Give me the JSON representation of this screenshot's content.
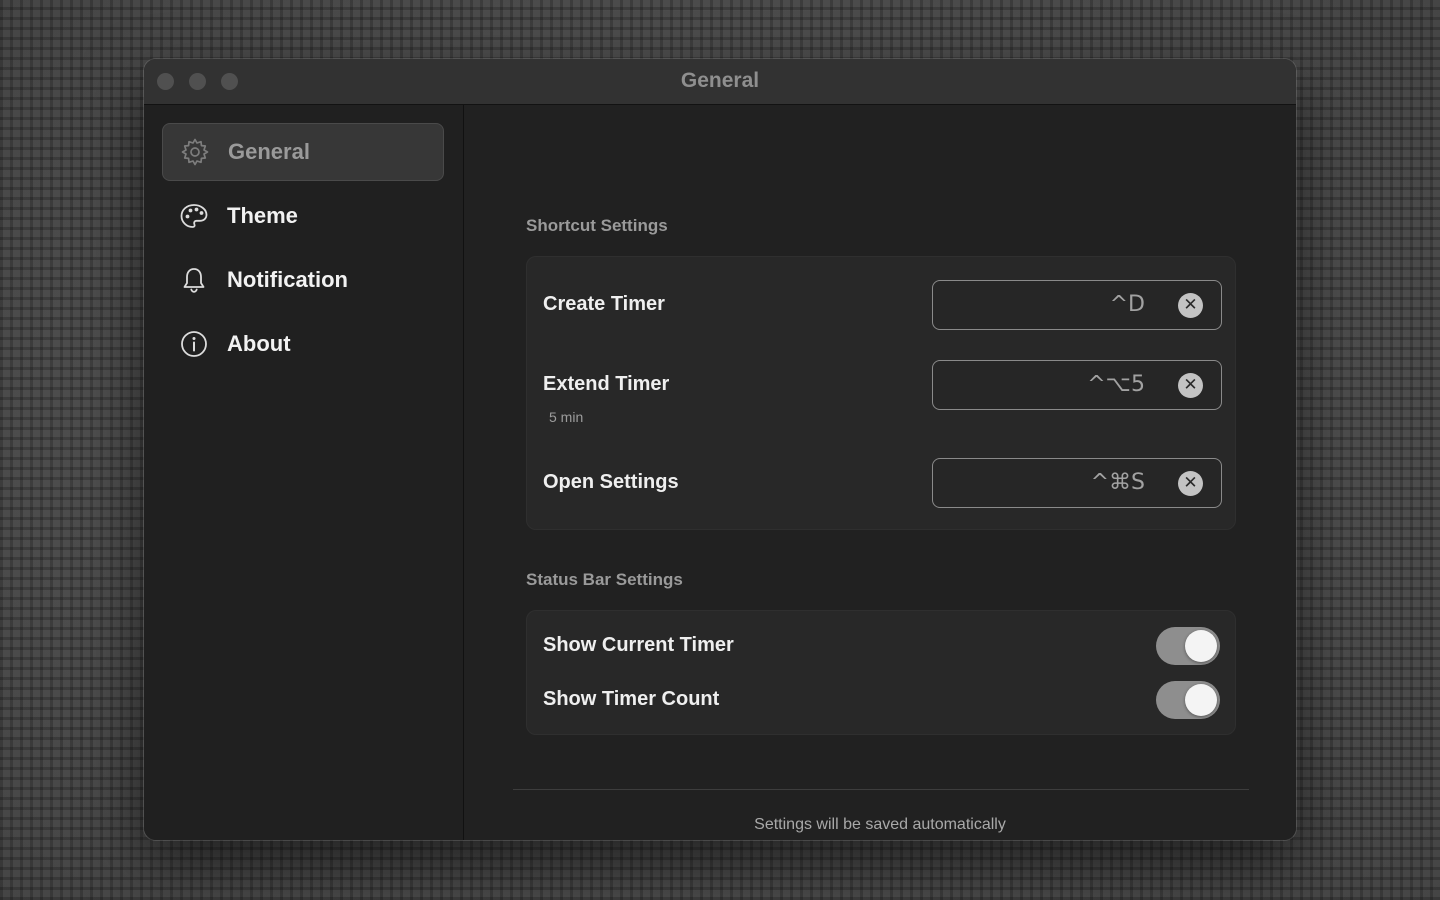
{
  "window": {
    "title": "General"
  },
  "sidebar": {
    "items": [
      {
        "label": "General",
        "icon": "gear-icon",
        "active": true
      },
      {
        "label": "Theme",
        "icon": "palette-icon",
        "active": false
      },
      {
        "label": "Notification",
        "icon": "bell-icon",
        "active": false
      },
      {
        "label": "About",
        "icon": "info-icon",
        "active": false
      }
    ]
  },
  "shortcut_settings": {
    "title": "Shortcut Settings",
    "rows": [
      {
        "label": "Create Timer",
        "sublabel": "",
        "keys": "^D"
      },
      {
        "label": "Extend Timer",
        "sublabel": "5 min",
        "keys": "^⌥5"
      },
      {
        "label": "Open Settings",
        "sublabel": "",
        "keys": "^⌘S"
      }
    ],
    "clear_symbol": "✕"
  },
  "status_bar_settings": {
    "title": "Status Bar Settings",
    "rows": [
      {
        "label": "Show Current Timer",
        "enabled": true
      },
      {
        "label": "Show Timer Count",
        "enabled": true
      }
    ]
  },
  "footer": {
    "text": "Settings will be saved automatically"
  },
  "colors": {
    "window_bg": "#1f1f1f",
    "card_bg": "#282828",
    "toggle_on": "#8e8e8e",
    "active_nav_bg": "#373737"
  }
}
